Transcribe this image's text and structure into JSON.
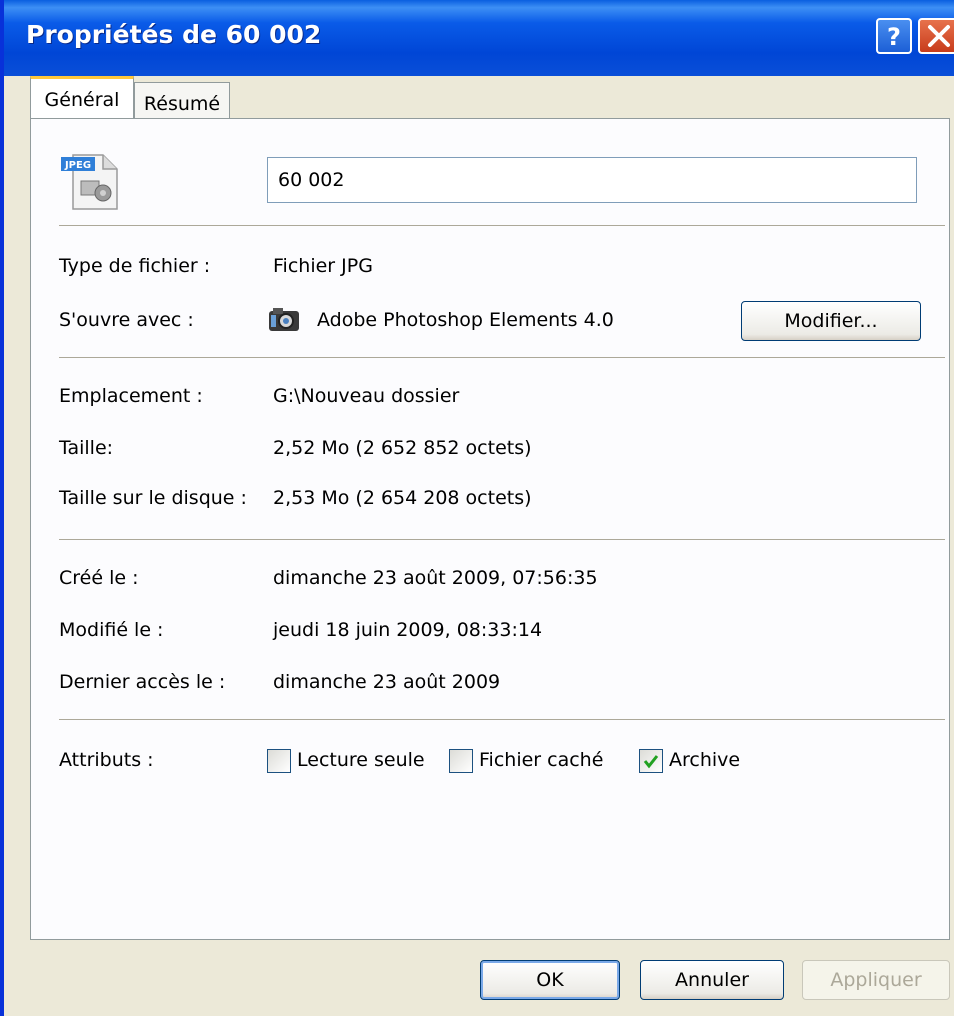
{
  "window": {
    "title": "Propriétés de 60 002"
  },
  "tabs": [
    {
      "label": "Général",
      "selected": true
    },
    {
      "label": "Résumé",
      "selected": false
    }
  ],
  "file": {
    "icon": "jpeg-file-icon",
    "name_value": "60 002"
  },
  "type_section": {
    "file_type_label": "Type de fichier :",
    "file_type_value": "Fichier JPG",
    "opens_with_label": "S'ouvre avec :",
    "opens_with_app": "Adobe Photoshop Elements 4.0",
    "opens_with_icon": "photoshop-elements-icon",
    "change_button": "Modifier..."
  },
  "location_section": {
    "location_label": "Emplacement :",
    "location_value": "G:\\Nouveau dossier",
    "size_label": "Taille:",
    "size_value": "2,52 Mo (2 652 852 octets)",
    "disk_size_label": "Taille sur le disque :",
    "disk_size_value": "2,53 Mo (2 654 208 octets)"
  },
  "dates_section": {
    "created_label": "Créé le :",
    "created_value": "dimanche 23 août 2009, 07:56:35",
    "modified_label": "Modifié le :",
    "modified_value": "jeudi 18 juin 2009, 08:33:14",
    "accessed_label": "Dernier accès le :",
    "accessed_value": "dimanche 23 août 2009"
  },
  "attributes": {
    "label": "Attributs :",
    "read_only": {
      "label": "Lecture seule",
      "checked": false
    },
    "hidden": {
      "label": "Fichier caché",
      "checked": false
    },
    "archive": {
      "label": "Archive",
      "checked": true
    }
  },
  "footer": {
    "ok": "OK",
    "cancel": "Annuler",
    "apply": "Appliquer"
  },
  "colors": {
    "titlebar": "#0046d6",
    "dialog_bg": "#ece9d8",
    "tab_highlight": "#ffc83c",
    "check_mark": "#21a121"
  }
}
